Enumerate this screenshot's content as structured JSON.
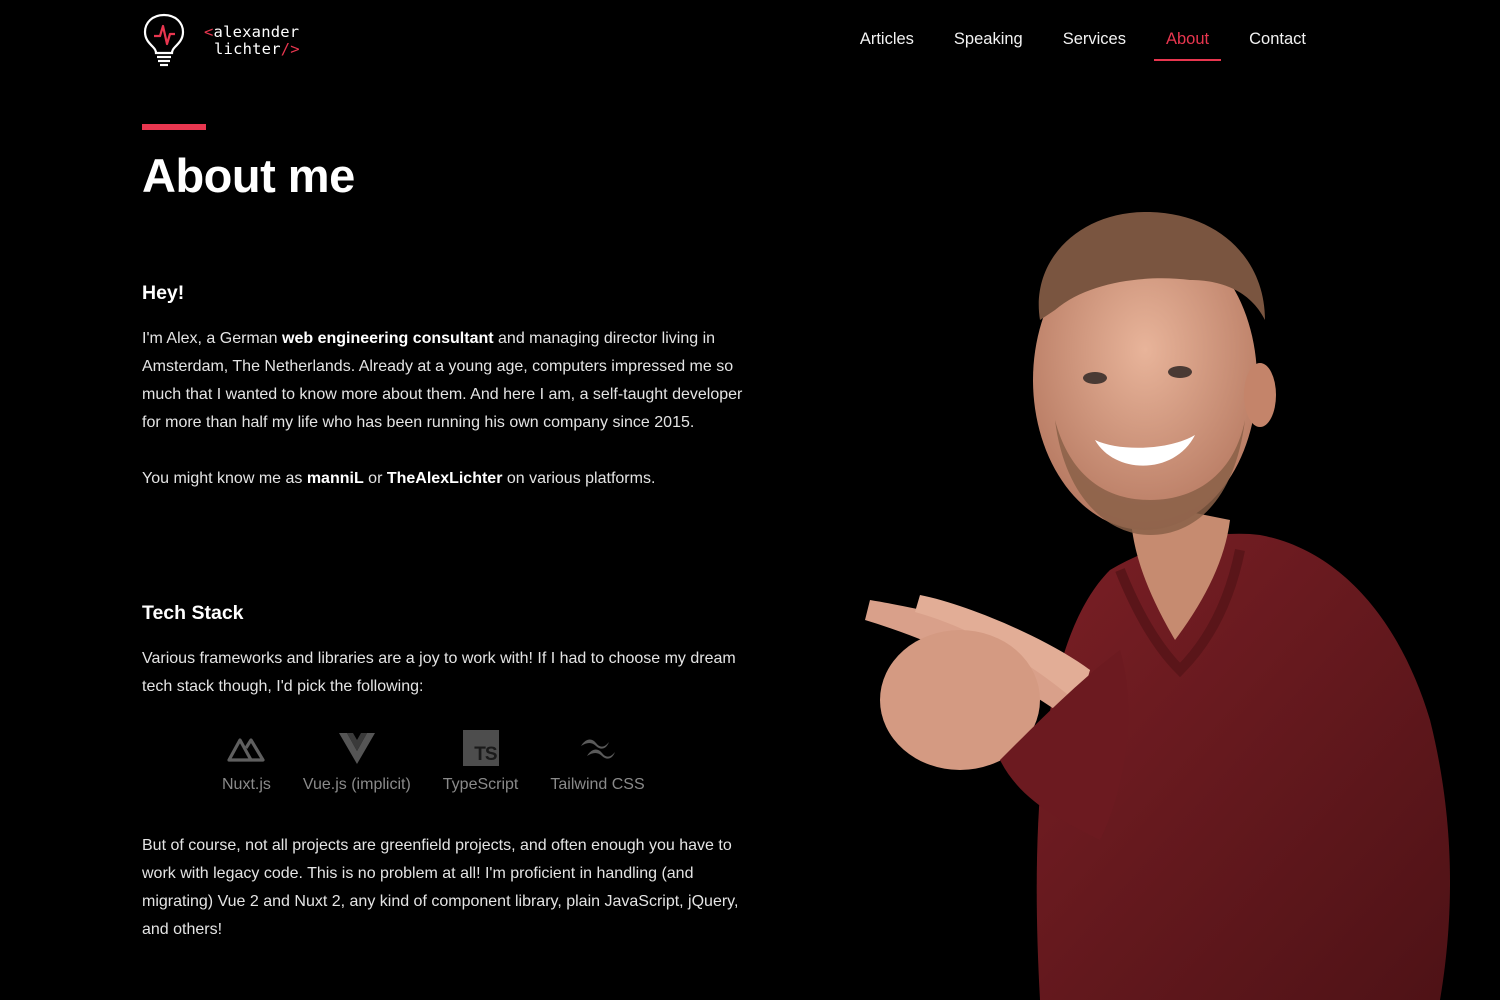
{
  "header": {
    "logo": {
      "text_line1_prefix": "<",
      "text_line1": "alexander",
      "text_line2": "lichter",
      "text_line2_suffix": "/>"
    },
    "nav": [
      {
        "label": "Articles",
        "active": false
      },
      {
        "label": "Speaking",
        "active": false
      },
      {
        "label": "Services",
        "active": false
      },
      {
        "label": "About",
        "active": true
      },
      {
        "label": "Contact",
        "active": false
      }
    ]
  },
  "main": {
    "title": "About me",
    "intro": {
      "heading": "Hey!",
      "p1_a": "I'm Alex, a German ",
      "p1_bold": "web engineering consultant",
      "p1_b": " and managing director living in Amsterdam, The Netherlands. Already at a young age, computers impressed me so much that I wanted to know more about them. And here I am, a self-taught developer for more than half my life who has been running his own company since 2015.",
      "p2_a": "You might know me as ",
      "p2_bold1": "manniL",
      "p2_b": " or ",
      "p2_bold2": "TheAlexLichter",
      "p2_c": " on various platforms."
    },
    "tech": {
      "heading": "Tech Stack",
      "p1": "Various frameworks and libraries are a joy to work with! If I had to choose my dream tech stack though, I'd pick the following:",
      "items": [
        {
          "label": "Nuxt.js",
          "icon": "nuxt-icon"
        },
        {
          "label": "Vue.js (implicit)",
          "icon": "vue-icon"
        },
        {
          "label": "TypeScript",
          "icon": "typescript-icon",
          "icon_text": "TS"
        },
        {
          "label": "Tailwind CSS",
          "icon": "tailwind-icon"
        }
      ],
      "p2": "But of course, not all projects are greenfield projects, and often enough you have to work with legacy code. This is no problem at all! I'm proficient in handling (and migrating) Vue 2 and Nuxt 2, any kind of component library, plain JavaScript, jQuery, and others!"
    }
  },
  "colors": {
    "accent": "#e8364f",
    "background": "#000000",
    "muted": "#8a8a8a",
    "sweater": "#6e1a1f"
  }
}
